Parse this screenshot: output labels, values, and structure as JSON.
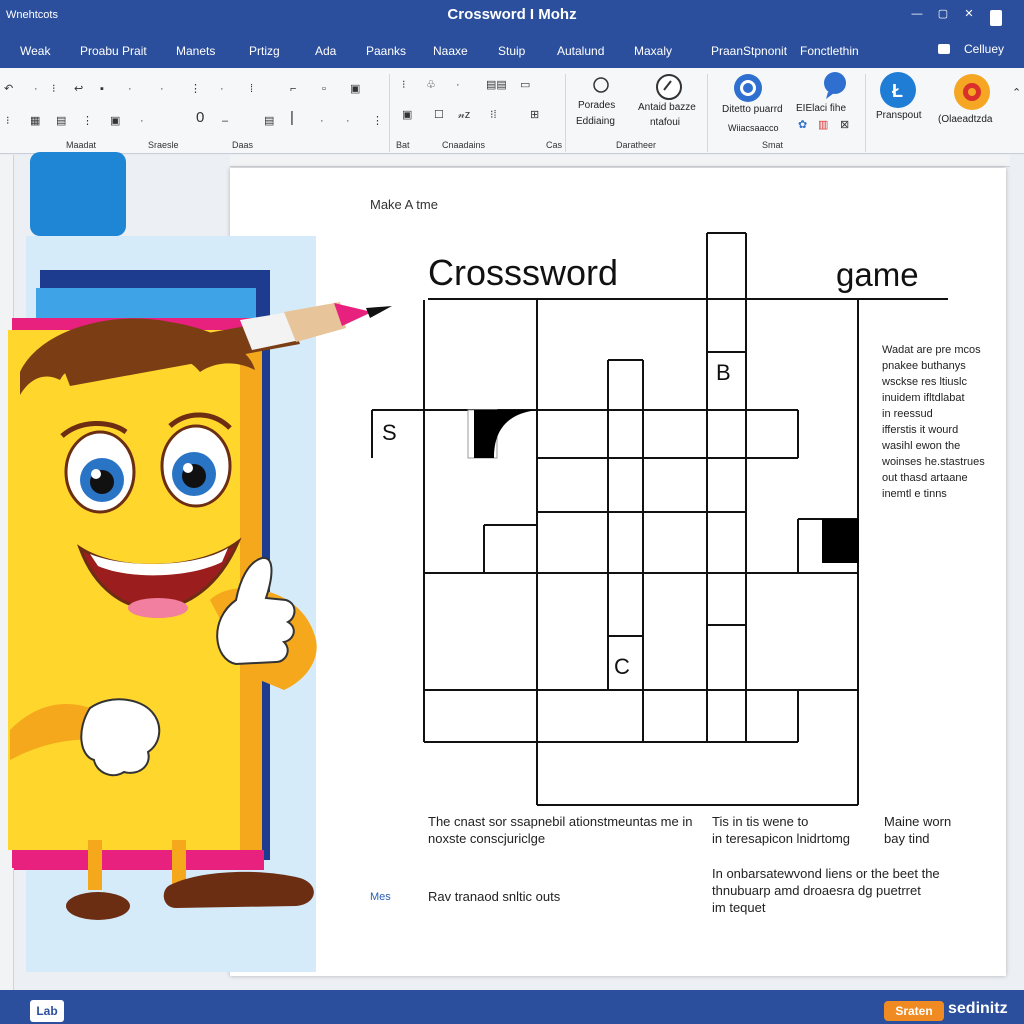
{
  "titlebar": {
    "app_name": "Wnehtcots",
    "doc_title": "Crossword I Mohz",
    "controls": [
      "—",
      "▢",
      "✕"
    ]
  },
  "tabs": [
    {
      "label": "Weak"
    },
    {
      "label": "Proabu Prait"
    },
    {
      "label": "Manets"
    },
    {
      "label": "Prtizg"
    },
    {
      "label": "Ada"
    },
    {
      "label": "Paanks"
    },
    {
      "label": "Naaxe"
    },
    {
      "label": "Stuip"
    },
    {
      "label": "Autalund"
    },
    {
      "label": "Maxaly"
    },
    {
      "label": "PraanStpnonit"
    },
    {
      "label": "Fonctlethin"
    }
  ],
  "account": {
    "label": "Celluey"
  },
  "ribbon": {
    "groups": [
      {
        "label": "Maadat"
      },
      {
        "label": "Sraesle"
      },
      {
        "label": "Daas"
      },
      {
        "label": "Bat"
      },
      {
        "label": "Cnaadains"
      },
      {
        "label": "Cas"
      },
      {
        "label": "Daratheer"
      },
      {
        "label": "Smat"
      }
    ],
    "big_buttons": [
      {
        "line1": "Porades",
        "line2": "Eddiaing"
      },
      {
        "line1": "Antaid bazze",
        "line2": "ntafoui"
      },
      {
        "line1": "Ditetto puarrd",
        "line2": "Wiiacsaacco"
      },
      {
        "line1": "EIElaci fihe",
        "line2": ""
      },
      {
        "line1": "Pranspout",
        "line2": ""
      },
      {
        "line1": "(Olaeadtzda",
        "line2": ""
      }
    ],
    "icon_colors": {
      "blue": "#2f6fd0",
      "orange": "#f08a22",
      "red": "#d9302c"
    }
  },
  "document": {
    "make_label": "Make A tme",
    "heading_left": "Crosssword",
    "heading_right": "game",
    "grid_letters": [
      "B",
      "S",
      "C"
    ],
    "side_clues": [
      "Wadat are pre mcos",
      "pnakee buthanys",
      "wsckse res ltiuslc",
      "inuidem ifltdlabat",
      "in reessud",
      "ifferstis it wourd",
      "wasihl ewon the",
      "woinses he.stastrues",
      "out thasd artaane",
      "inemtl e tinns"
    ],
    "bottom_clues": {
      "c1_l1": "The cnast sor ssapnebil ationstmeuntas me in",
      "c1_l2": "noxste conscjuriclge",
      "c2_l1": "Tis in tis wene to",
      "c2_l2": "in teresapicon lnidrtomg",
      "c3_l1": "Maine worn",
      "c3_l2": "bay tind",
      "c4_l1": "In onbarsatewvond liens or the beet the",
      "c4_l2": "thnubuarp amd droaesra dg puetrret",
      "c4_l3": "im tequet",
      "mes": "Mes",
      "c5": "Rav tranaod snltic outs"
    }
  },
  "statusbar": {
    "left": "Lab",
    "badge": "Sraten",
    "right": "sedinitz"
  }
}
